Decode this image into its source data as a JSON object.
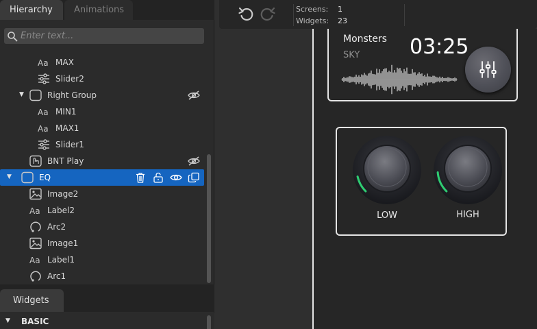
{
  "hierarchy": {
    "tabs": [
      {
        "label": "Hierarchy",
        "active": true
      },
      {
        "label": "Animations",
        "active": false
      }
    ],
    "search": {
      "placeholder": "Enter text...",
      "value": ""
    },
    "rows": [
      {
        "label": "MAX",
        "icon": "label-icon",
        "indent": 2,
        "expander": "none",
        "selected": false,
        "hidden_toggle": false
      },
      {
        "label": "Slider2",
        "icon": "slider-icon",
        "indent": 2,
        "expander": "none",
        "selected": false,
        "hidden_toggle": false
      },
      {
        "label": "Right Group",
        "icon": "container-icon",
        "indent": 1,
        "expander": "expanded",
        "selected": false,
        "hidden_toggle": true
      },
      {
        "label": "MIN1",
        "icon": "label-icon",
        "indent": 2,
        "expander": "none",
        "selected": false,
        "hidden_toggle": false
      },
      {
        "label": "MAX1",
        "icon": "label-icon",
        "indent": 2,
        "expander": "none",
        "selected": false,
        "hidden_toggle": false
      },
      {
        "label": "Slider1",
        "icon": "slider-icon",
        "indent": 2,
        "expander": "none",
        "selected": false,
        "hidden_toggle": false
      },
      {
        "label": "BNT Play",
        "icon": "button-icon",
        "indent": 1,
        "expander": "none",
        "selected": false,
        "hidden_toggle": true
      },
      {
        "label": "EQ",
        "icon": "container-icon",
        "indent": 0,
        "expander": "expanded",
        "selected": true,
        "hidden_toggle": false
      },
      {
        "label": "Image2",
        "icon": "image-icon",
        "indent": 1,
        "expander": "none",
        "selected": false,
        "hidden_toggle": false
      },
      {
        "label": "Label2",
        "icon": "label-icon",
        "indent": 1,
        "expander": "none",
        "selected": false,
        "hidden_toggle": false
      },
      {
        "label": "Arc2",
        "icon": "arc-icon",
        "indent": 1,
        "expander": "none",
        "selected": false,
        "hidden_toggle": false
      },
      {
        "label": "Image1",
        "icon": "image-icon",
        "indent": 1,
        "expander": "none",
        "selected": false,
        "hidden_toggle": false
      },
      {
        "label": "Label1",
        "icon": "label-icon",
        "indent": 1,
        "expander": "none",
        "selected": false,
        "hidden_toggle": false
      },
      {
        "label": "Arc1",
        "icon": "arc-icon",
        "indent": 1,
        "expander": "none",
        "selected": false,
        "hidden_toggle": false
      }
    ]
  },
  "widgets_panel": {
    "tab_label": "Widgets",
    "category_label": "BASIC"
  },
  "toolbar": {
    "undo": "undo-icon",
    "redo": "redo-icon",
    "screens_label": "Screens:",
    "screens_value": "1",
    "widgets_label": "Widgets:",
    "widgets_value": "23"
  },
  "canvas": {
    "player": {
      "title": "Monsters",
      "subtitle": "SKY",
      "time": "03:25",
      "eq_button_icon": "equalizer-sliders-icon"
    },
    "eq": {
      "knobs": [
        {
          "label": "LOW",
          "level": 0.12
        },
        {
          "label": "HIGH",
          "level": 0.15
        }
      ],
      "accent_color": "#2ecc71"
    }
  },
  "colors": {
    "selection": "#1565c0",
    "panel": "#2b2b2b",
    "canvas_bg": "#262626",
    "outline": "#e5e5e5"
  }
}
